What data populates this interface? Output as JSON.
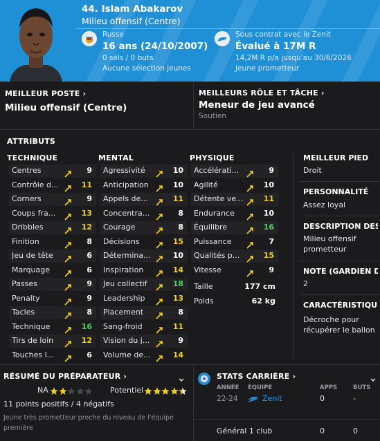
{
  "header": {
    "name": "44. Islam Abakarov",
    "position": "Milieu offensif (Centre)",
    "nationality": "Russe",
    "age": "16 ans (24/10/2007)",
    "apps": "0 séls / 0 buts",
    "selection": "Aucune sélection jeunes",
    "contract": "Sous contrat avec le Zenit",
    "value": "Évalué à 17M R",
    "salary": "14,2M R p/a jusqu'au 30/6/2026",
    "status": "Jeune prometteur"
  },
  "best_position": {
    "title": "MEILLEUR POSTE",
    "value": "Milieu offensif (Centre)"
  },
  "best_role": {
    "title": "MEILLEURS RÔLE ET TÂCHE",
    "value": "Meneur de jeu avancé",
    "duty": "Soutien"
  },
  "attributes": {
    "title": "ATTRIBUTS",
    "technical": {
      "title": "TECHNIQUE",
      "rows": [
        {
          "name": "Centres",
          "value": "9",
          "color": "#ffffff"
        },
        {
          "name": "Contrôle d...",
          "value": "11",
          "color": "#f2d21b"
        },
        {
          "name": "Corners",
          "value": "9",
          "color": "#ffffff"
        },
        {
          "name": "Coups fra...",
          "value": "13",
          "color": "#f2d21b"
        },
        {
          "name": "Dribbles",
          "value": "12",
          "color": "#f2d21b"
        },
        {
          "name": "Finition",
          "value": "8",
          "color": "#ffffff"
        },
        {
          "name": "Jeu de tête",
          "value": "6",
          "color": "#ffffff"
        },
        {
          "name": "Marquage",
          "value": "6",
          "color": "#ffffff"
        },
        {
          "name": "Passes",
          "value": "9",
          "color": "#ffffff"
        },
        {
          "name": "Penalty",
          "value": "9",
          "color": "#ffffff"
        },
        {
          "name": "Tacles",
          "value": "8",
          "color": "#ffffff"
        },
        {
          "name": "Technique",
          "value": "16",
          "color": "#4fd160"
        },
        {
          "name": "Tirs de loin",
          "value": "12",
          "color": "#f2d21b"
        },
        {
          "name": "Touches l...",
          "value": "6",
          "color": "#ffffff"
        }
      ]
    },
    "mental": {
      "title": "MENTAL",
      "rows": [
        {
          "name": "Agressivité",
          "value": "10",
          "color": "#ffffff"
        },
        {
          "name": "Anticipation",
          "value": "10",
          "color": "#ffffff"
        },
        {
          "name": "Appels de...",
          "value": "11",
          "color": "#f2d21b"
        },
        {
          "name": "Concentra...",
          "value": "8",
          "color": "#ffffff"
        },
        {
          "name": "Courage",
          "value": "8",
          "color": "#ffffff"
        },
        {
          "name": "Décisions",
          "value": "15",
          "color": "#f2d21b"
        },
        {
          "name": "Détermina...",
          "value": "10",
          "color": "#ffffff"
        },
        {
          "name": "Inspiration",
          "value": "14",
          "color": "#f2d21b"
        },
        {
          "name": "Jeu collectif",
          "value": "18",
          "color": "#4fd160"
        },
        {
          "name": "Leadership",
          "value": "13",
          "color": "#f2d21b"
        },
        {
          "name": "Placement",
          "value": "8",
          "color": "#ffffff"
        },
        {
          "name": "Sang-froid",
          "value": "11",
          "color": "#f2d21b"
        },
        {
          "name": "Vision du j...",
          "value": "9",
          "color": "#ffffff"
        },
        {
          "name": "Volume de...",
          "value": "14",
          "color": "#f2d21b"
        }
      ]
    },
    "physical": {
      "title": "PHYSIQUE",
      "rows": [
        {
          "name": "Accélérati...",
          "value": "9",
          "color": "#ffffff"
        },
        {
          "name": "Agilité",
          "value": "10",
          "color": "#ffffff"
        },
        {
          "name": "Détente ve...",
          "value": "11",
          "color": "#f2d21b"
        },
        {
          "name": "Endurance",
          "value": "10",
          "color": "#ffffff"
        },
        {
          "name": "Équilibre",
          "value": "16",
          "color": "#4fd160"
        },
        {
          "name": "Puissance",
          "value": "7",
          "color": "#ffffff"
        },
        {
          "name": "Qualités p...",
          "value": "15",
          "color": "#f2d21b"
        },
        {
          "name": "Vitesse",
          "value": "9",
          "color": "#ffffff"
        }
      ],
      "height_label": "Taille",
      "height": "177 cm",
      "weight_label": "Poids",
      "weight": "62 kg"
    }
  },
  "side": {
    "foot_title": "MEILLEUR PIED",
    "foot": "Droit",
    "personality_title": "PERSONNALITÉ",
    "personality": "Assez loyal",
    "desc_title": "DESCRIPTION DES...",
    "desc": "Milieu offensif prometteur",
    "gk_title": "NOTE (GARDIEN D...",
    "gk": "2",
    "char_title": "CARACTÉRISTIQU...",
    "char": "Décroche pour récupérer le ballon"
  },
  "coach": {
    "title": "RÉSUMÉ DU PRÉPARATEUR",
    "na_label": "NA",
    "na_stars": 2,
    "potential_label": "Potentiel",
    "potential_stars": 4.5,
    "summary": "11 points positifs / 4 négatifs",
    "note": "Jeune très prometteur proche du niveau de l'équipe première"
  },
  "career": {
    "title": "STATS CARRIÈRE",
    "col_year": "ANNÉE",
    "col_team": "ÉQUIPE",
    "col_apps": "APPS",
    "col_goals": "BUTS",
    "rows": [
      {
        "year": "22-24",
        "team": "Zenit",
        "apps": "0",
        "goals": "-"
      }
    ],
    "total_label": "Général 1 club",
    "total_apps": "0",
    "total_goals": "0"
  },
  "colors": {
    "header": "#1f8fd6",
    "green": "#4fd160",
    "yellow": "#f2d21b",
    "star": "#f2d21b"
  }
}
